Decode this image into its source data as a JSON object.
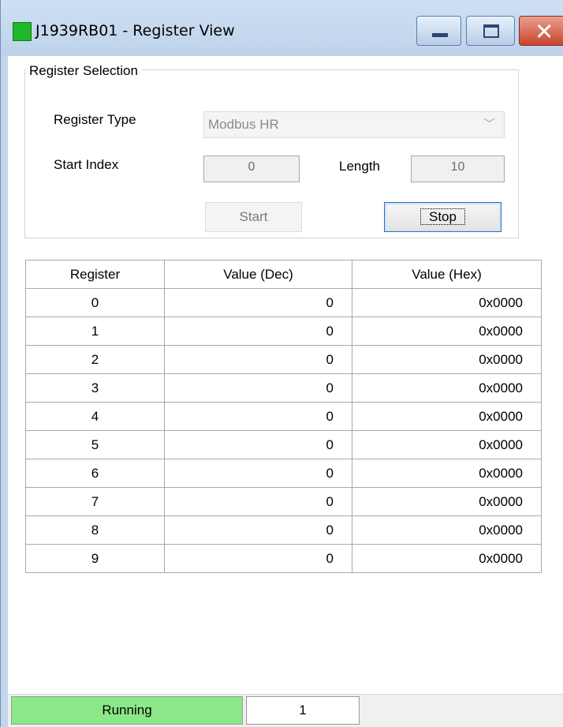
{
  "window": {
    "title": "J1939RB01 - Register View",
    "icon_color": "#1fb82b"
  },
  "register_selection": {
    "group_label": "Register Selection",
    "register_type_label": "Register Type",
    "register_type_value": "Modbus HR",
    "start_index_label": "Start Index",
    "start_index_value": "0",
    "length_label": "Length",
    "length_value": "10",
    "start_button": "Start",
    "stop_button": "Stop"
  },
  "table": {
    "columns": [
      "Register",
      "Value (Dec)",
      "Value (Hex)"
    ],
    "rows": [
      [
        "0",
        "0",
        "0x0000"
      ],
      [
        "1",
        "0",
        "0x0000"
      ],
      [
        "2",
        "0",
        "0x0000"
      ],
      [
        "3",
        "0",
        "0x0000"
      ],
      [
        "4",
        "0",
        "0x0000"
      ],
      [
        "5",
        "0",
        "0x0000"
      ],
      [
        "6",
        "0",
        "0x0000"
      ],
      [
        "7",
        "0",
        "0x0000"
      ],
      [
        "8",
        "0",
        "0x0000"
      ],
      [
        "9",
        "0",
        "0x0000"
      ]
    ]
  },
  "status": {
    "state": "Running",
    "state_color": "#8ae888",
    "count": "1"
  }
}
